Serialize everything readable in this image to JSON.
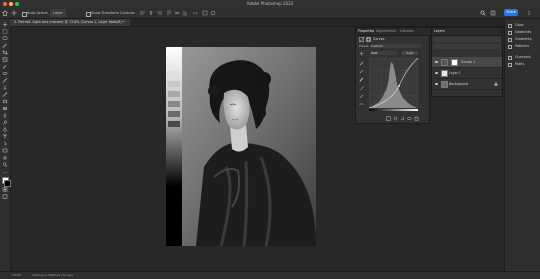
{
  "app": {
    "title": "Adobe Photoshop 2022"
  },
  "options_bar": {
    "auto_select_label": "Auto-Select:",
    "auto_select_value": "Layer",
    "transform_controls_label": "Show Transform Controls",
    "share_label": "Share"
  },
  "document": {
    "tab_label": "5. Portrait- Light test (resized) @ 73.6% (Curves 1, Layer Mask/8) *"
  },
  "status_bar": {
    "zoom": "73.6%",
    "doc_info": "1414 px x 1920 px (72 ppi)"
  },
  "properties_panel": {
    "tabs": [
      "Properties",
      "Adjustments",
      "Libraries"
    ],
    "section_label": "Curves",
    "preset_label": "Preset:",
    "preset_value": "Custom",
    "channel_value": "RGB",
    "auto_label": "Auto"
  },
  "layers_panel": {
    "tab_label": "Layers",
    "rows": [
      {
        "name": "Curves 1"
      },
      {
        "name": "Layer 1"
      },
      {
        "name": "Background"
      }
    ]
  },
  "right_panel": {
    "items": [
      {
        "label": "Color",
        "icon": "color-icon"
      },
      {
        "label": "Swatches",
        "icon": "swatches-icon"
      },
      {
        "label": "Gradients",
        "icon": "gradients-icon"
      },
      {
        "label": "Patterns",
        "icon": "patterns-icon"
      },
      {
        "label": "Channels",
        "icon": "channels-icon"
      },
      {
        "label": "Paths",
        "icon": "paths-icon"
      }
    ]
  },
  "colors": {
    "accent": "#2a73e8",
    "panel": "#323232",
    "canvas": "#282828"
  }
}
